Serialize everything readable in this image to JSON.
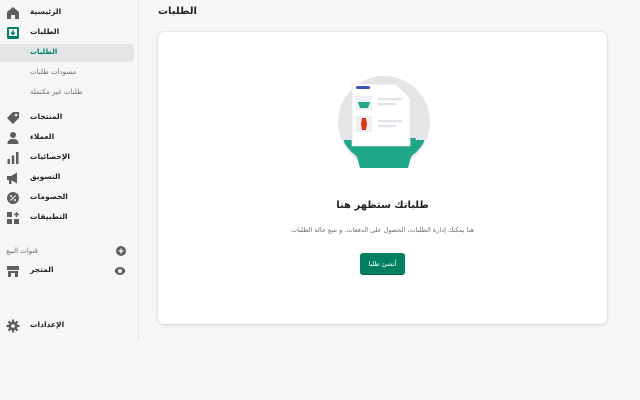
{
  "sidebar": {
    "items": [
      {
        "label": "الرئيسية",
        "icon": "home-icon"
      },
      {
        "label": "الطلبات",
        "icon": "orders-icon"
      },
      {
        "label": "المنتجات",
        "icon": "tag-icon"
      },
      {
        "label": "العملاء",
        "icon": "person-icon"
      },
      {
        "label": "الإحصائيات",
        "icon": "bar-chart-icon"
      },
      {
        "label": "التسويق",
        "icon": "megaphone-icon"
      },
      {
        "label": "الخصومات",
        "icon": "discount-icon"
      },
      {
        "label": "التطبيقات",
        "icon": "apps-icon"
      }
    ],
    "orders_subitems": [
      {
        "label": "الطلبات",
        "active": true
      },
      {
        "label": "مسودات طلبات",
        "active": false
      },
      {
        "label": "طلبات غير مكتملة",
        "active": false
      }
    ],
    "sales_channels_label": "قنوات البيع",
    "online_store_label": "المتجر",
    "settings_label": "الإعدادات"
  },
  "header": {
    "title": "الطلبات"
  },
  "empty_state": {
    "heading": "طلباتك ستظهر هنا",
    "text": "هنا يمكنك إدارة الطلبات، الحصول على الدفعات، و تتبع حالة الطلبات",
    "button_label": "أنشئ طلبا"
  },
  "colors": {
    "accent": "#008060",
    "sidebar_bg": "#f6f6f7",
    "illustration_circle": "#e4e5e7",
    "illustration_teal": "#1fa888"
  }
}
